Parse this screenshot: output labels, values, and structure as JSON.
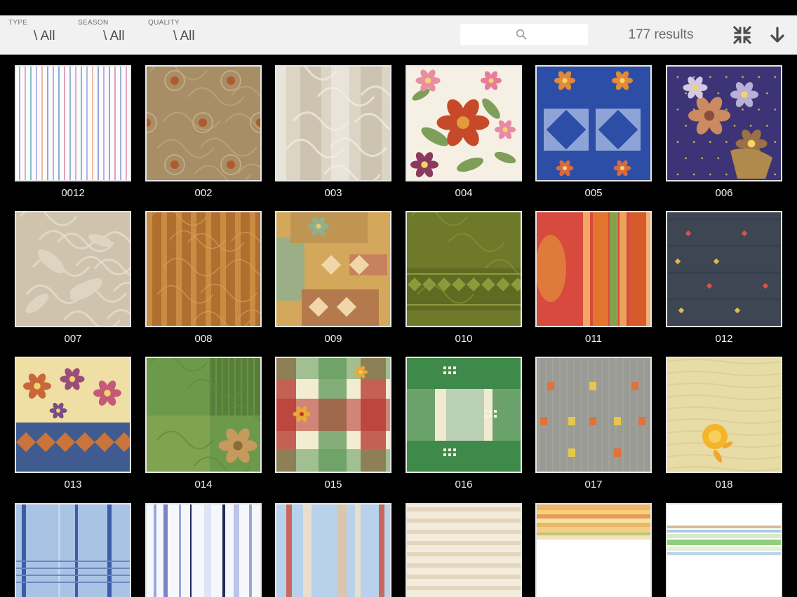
{
  "filters": {
    "type": {
      "label": "TYPE",
      "value": "\\ All"
    },
    "season": {
      "label": "SEASON",
      "value": "\\ All"
    },
    "quality": {
      "label": "QUALITY",
      "value": "\\ All"
    }
  },
  "search": {
    "placeholder": ""
  },
  "results_text": "177 results",
  "toolbar": {
    "collapse_icon": "collapse-arrows-icon",
    "download_icon": "arrow-down-icon"
  },
  "items": [
    {
      "code": "0012",
      "pattern": "pinstripe-multicolor"
    },
    {
      "code": "002",
      "pattern": "damask-tan"
    },
    {
      "code": "003",
      "pattern": "stripe-damask-beige"
    },
    {
      "code": "004",
      "pattern": "floral-white"
    },
    {
      "code": "005",
      "pattern": "tapestry-blue"
    },
    {
      "code": "006",
      "pattern": "floral-purple"
    },
    {
      "code": "007",
      "pattern": "floral-beige"
    },
    {
      "code": "008",
      "pattern": "stripe-ochre"
    },
    {
      "code": "009",
      "pattern": "patchwork-ochre"
    },
    {
      "code": "010",
      "pattern": "border-olive"
    },
    {
      "code": "011",
      "pattern": "stripe-red-orange"
    },
    {
      "code": "012",
      "pattern": "dots-slate"
    },
    {
      "code": "013",
      "pattern": "floral-tapestry"
    },
    {
      "code": "014",
      "pattern": "patchwork-green"
    },
    {
      "code": "015",
      "pattern": "plaid-red-green"
    },
    {
      "code": "016",
      "pattern": "check-green"
    },
    {
      "code": "017",
      "pattern": "dots-grey"
    },
    {
      "code": "018",
      "pattern": "rose-cream"
    },
    {
      "code": "",
      "pattern": "plaid-blue"
    },
    {
      "code": "",
      "pattern": "stripe-white-blue"
    },
    {
      "code": "",
      "pattern": "stripe-blue-pink"
    },
    {
      "code": "",
      "pattern": "stripe-cream"
    },
    {
      "code": "",
      "pattern": "stripe-sunset"
    },
    {
      "code": "",
      "pattern": "stripe-white-green"
    }
  ]
}
